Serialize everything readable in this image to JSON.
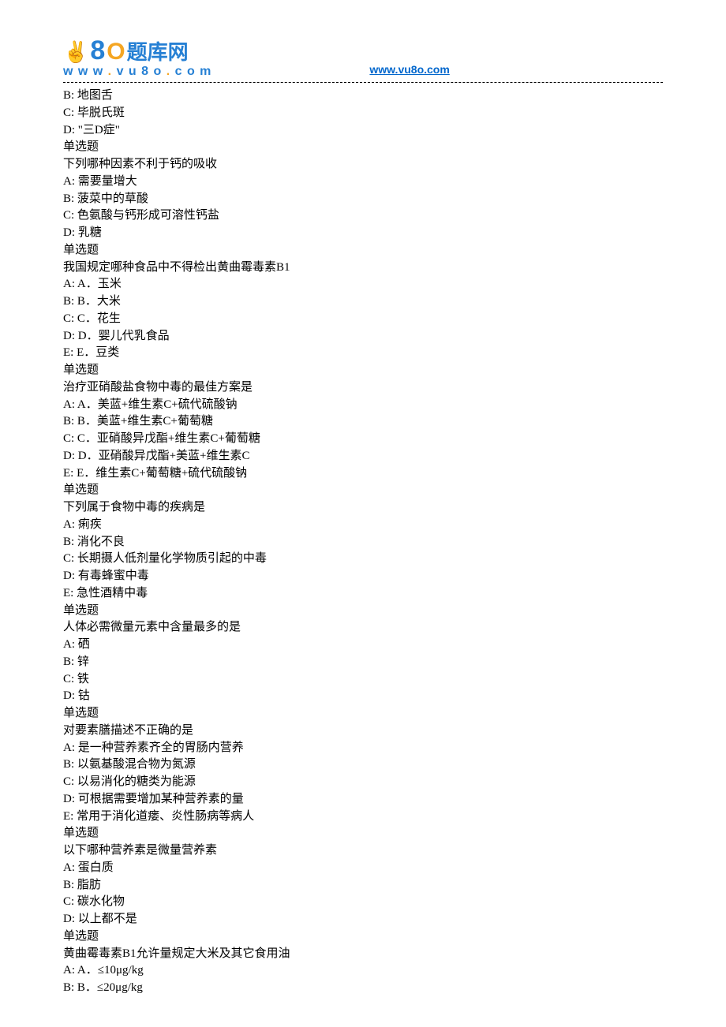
{
  "header": {
    "logo_cn": "题库网",
    "logo_url_display": "www.vu8o.com",
    "link_text": "www.vu8o.com",
    "link_href": "http://www.vu8o.com"
  },
  "lines": [
    "B: 地图舌",
    "C: 毕脱氏斑",
    "D: \"三D症\"",
    "单选题",
    "下列哪种因素不利于钙的吸收",
    "A: 需要量增大",
    "B: 菠菜中的草酸",
    "C: 色氨酸与钙形成可溶性钙盐",
    "D: 乳糖",
    "单选题",
    "我国规定哪种食品中不得检出黄曲霉毒素B1",
    "A: A．玉米",
    "B: B．大米",
    "C: C．花生",
    "D: D．婴儿代乳食品",
    "E: E．豆类",
    "单选题",
    "治疗亚硝酸盐食物中毒的最佳方案是",
    "A: A．美蓝+维生素C+硫代硫酸钠",
    "B: B．美蓝+维生素C+葡萄糖",
    "C: C．亚硝酸异戊酯+维生素C+葡萄糖",
    "D: D．亚硝酸异戊酯+美蓝+维生素C",
    "E: E．维生素C+葡萄糖+硫代硫酸钠",
    "单选题",
    "下列属于食物中毒的疾病是",
    "A: 痢疾",
    "B: 消化不良",
    "C: 长期摄人低剂量化学物质引起的中毒",
    "D: 有毒蜂蜜中毒",
    "E: 急性酒精中毒",
    "单选题",
    "人体必需微量元素中含量最多的是",
    "A: 硒",
    "B: 锌",
    "C: 铁",
    "D: 钴",
    "单选题",
    "对要素膳描述不正确的是",
    "A: 是一种营养素齐全的胃肠内营养",
    "B: 以氨基酸混合物为氮源",
    "C: 以易消化的糖类为能源",
    "D: 可根据需要增加某种营养素的量",
    "E: 常用于消化道瘘、炎性肠病等病人",
    "单选题",
    "以下哪种营养素是微量营养素",
    "A: 蛋白质",
    "B: 脂肪",
    "C: 碳水化物",
    "D: 以上都不是",
    "单选题",
    "黄曲霉毒素B1允许量规定大米及其它食用油",
    "A: A．≤10μg/kg",
    "B: B．≤20μg/kg"
  ]
}
